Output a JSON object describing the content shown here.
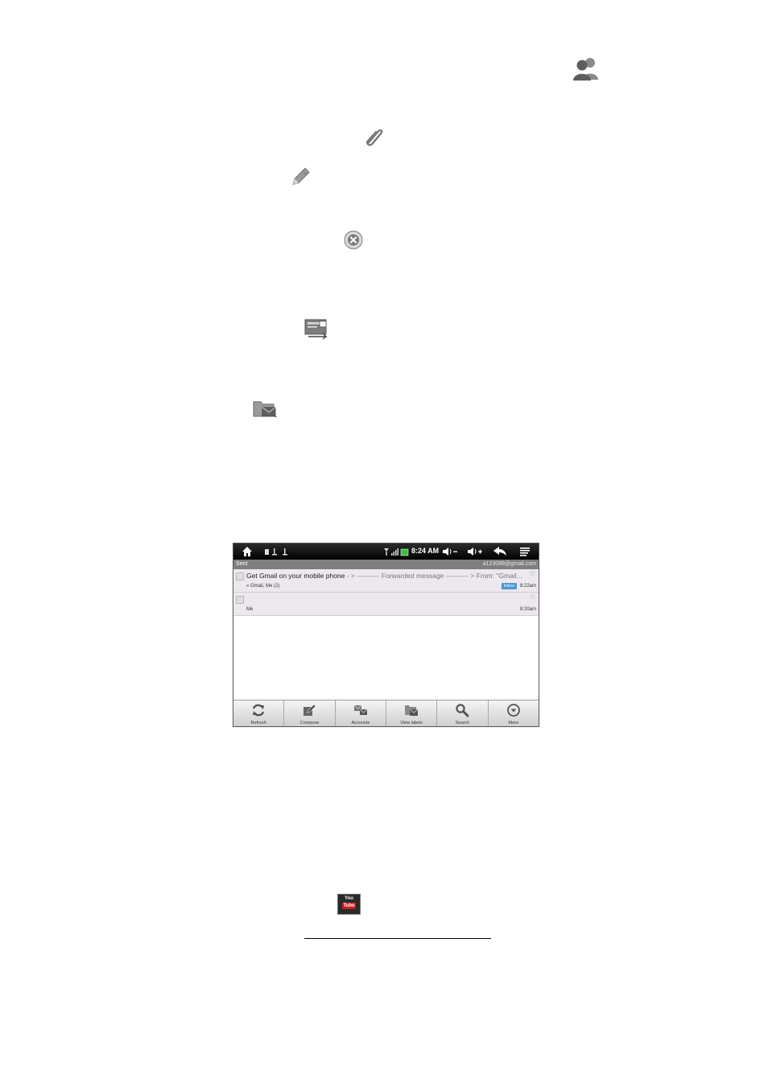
{
  "device": {
    "status": {
      "time": "8:24 AM"
    },
    "label_bar": {
      "label": "Sent",
      "account": "a123088@gmail.com"
    },
    "messages": [
      {
        "subject": "Get Gmail on your mobile phone",
        "snippet": " - > ---------- Forwarded message ---------- > From: \"Gmail...",
        "sender": "» Gmail, Me (2)",
        "tag": "Inbox",
        "time": "8:22am"
      },
      {
        "subject": "",
        "snippet": "",
        "sender": "Me",
        "tag": "",
        "time": "8:20am"
      }
    ],
    "toolbar": {
      "refresh": "Refresh",
      "compose": "Compose",
      "accounts": "Accounts",
      "view_labels": "View labels",
      "search": "Search",
      "more": "More"
    }
  },
  "youtube_logo": {
    "line1": "You",
    "line2": "Tube"
  }
}
